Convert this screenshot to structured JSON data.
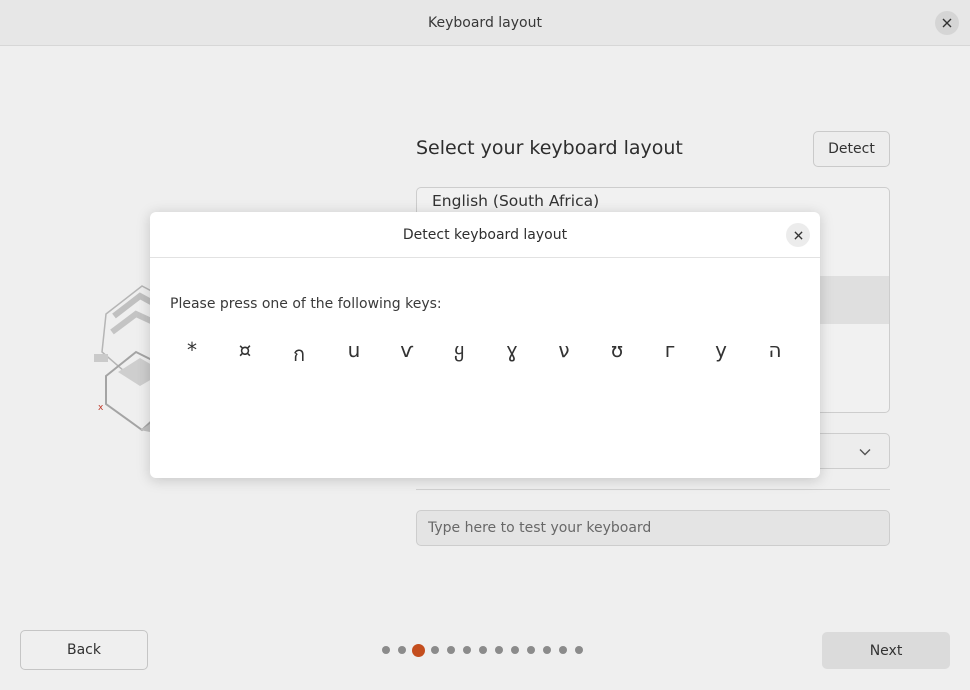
{
  "window": {
    "title": "Keyboard layout"
  },
  "main": {
    "heading": "Select your keyboard layout",
    "detect_label": "Detect",
    "layouts": [
      "English (South Africa)"
    ],
    "test_placeholder": "Type here to test your keyboard"
  },
  "footer": {
    "back_label": "Back",
    "next_label": "Next",
    "progress": {
      "current": 3,
      "total": 13
    }
  },
  "dialog": {
    "title": "Detect keyboard layout",
    "prompt": "Please press one of the following keys:",
    "keys": [
      "*",
      "¤",
      "ก",
      "ս",
      "ѵ",
      "ყ",
      "ɣ",
      "ν",
      "ʊ",
      "г",
      "у",
      "ה"
    ]
  },
  "colors": {
    "accent": "#c8501f"
  }
}
